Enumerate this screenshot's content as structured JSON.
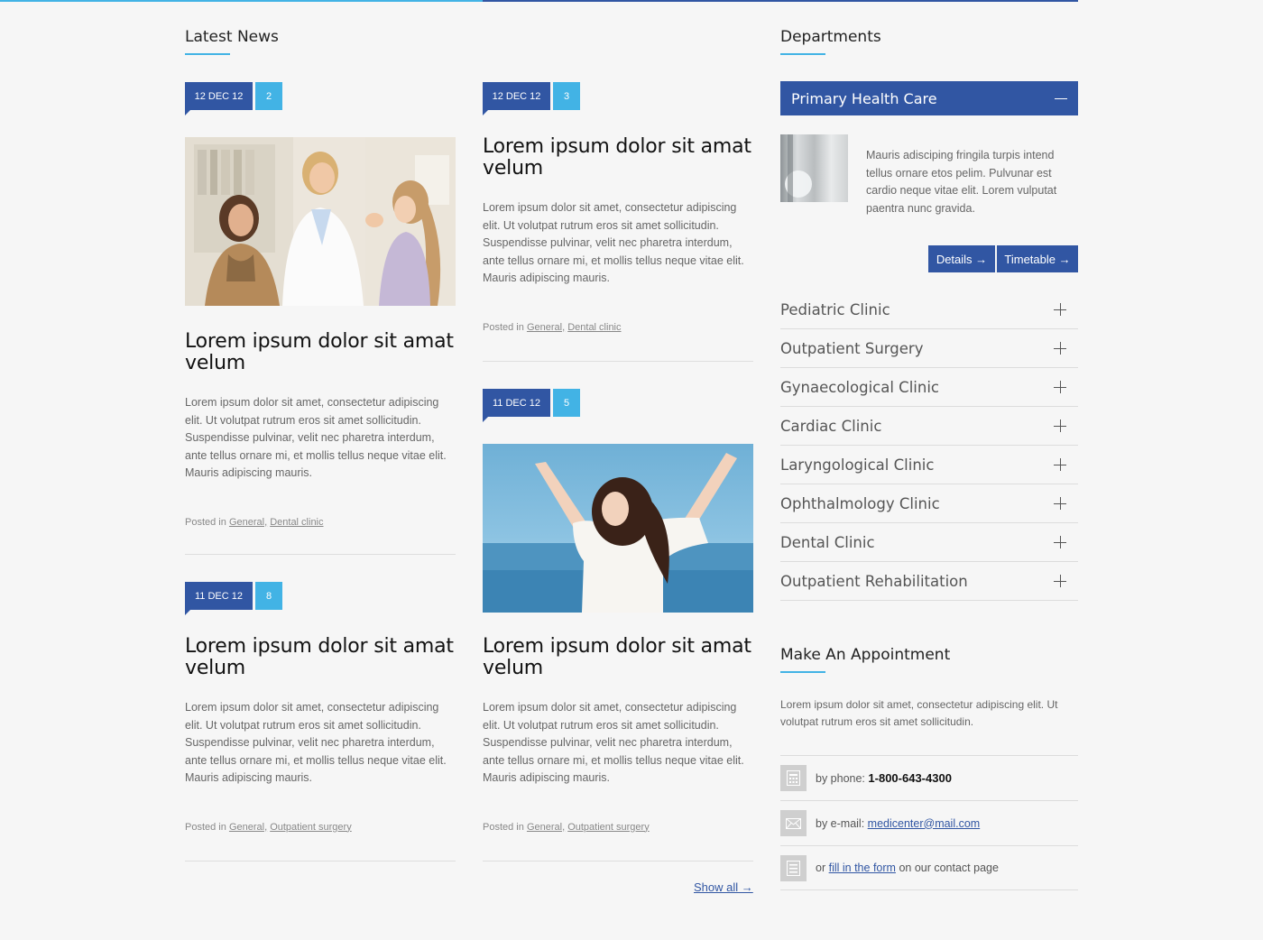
{
  "latest_news": {
    "heading": "Latest News",
    "articles": [
      {
        "date": "12 DEC 12",
        "comments": "2",
        "title": "Lorem ipsum dolor sit amat velum",
        "text": "Lorem ipsum dolor sit amet, consectetur adipiscing elit. Ut volutpat rutrum eros sit amet sollicitudin. Suspendisse pulvinar, velit nec pharetra interdum, ante tellus ornare mi, et mollis tellus neque vitae elit. Mauris adipiscing mauris.",
        "posted_in": "Posted in",
        "cat1": "General,",
        "cat2": "Dental clinic"
      },
      {
        "date": "12 DEC 12",
        "comments": "3",
        "title": "Lorem ipsum dolor sit amat velum",
        "text": "Lorem ipsum dolor sit amet, consectetur adipiscing elit. Ut volutpat rutrum eros sit amet sollicitudin. Suspendisse pulvinar, velit nec pharetra interdum, ante tellus ornare mi, et mollis tellus neque vitae elit. Mauris adipiscing mauris.",
        "posted_in": "Posted in",
        "cat1": "General,",
        "cat2": "Dental clinic"
      },
      {
        "date": "11 DEC 12",
        "comments": "5",
        "title": "Lorem ipsum dolor sit amat velum",
        "text": "Lorem ipsum dolor sit amet, consectetur adipiscing elit. Ut volutpat rutrum eros sit amet sollicitudin. Suspendisse pulvinar, velit nec pharetra interdum, ante tellus ornare mi, et mollis tellus neque vitae elit. Mauris adipiscing mauris.",
        "posted_in": "Posted in",
        "cat1": "General,",
        "cat2": "Outpatient surgery"
      },
      {
        "date": "11 DEC 12",
        "comments": "8",
        "title": "Lorem ipsum dolor sit amat velum",
        "text": "Lorem ipsum dolor sit amet, consectetur adipiscing elit. Ut volutpat rutrum eros sit amet sollicitudin. Suspendisse pulvinar, velit nec pharetra interdum, ante tellus ornare mi, et mollis tellus neque vitae elit. Mauris adipiscing mauris.",
        "posted_in": "Posted in",
        "cat1": "General,",
        "cat2": "Outpatient surgery"
      }
    ],
    "show_all": "Show all →"
  },
  "departments": {
    "heading": "Departments",
    "active": {
      "title": "Primary Health Care",
      "description": "Mauris adisciping fringila turpis intend tellus ornare etos pelim. Pulvunar est cardio neque vitae elit. Lorem vulputat paentra nunc gravida.",
      "details_label": "Details →",
      "timetable_label": "Timetable →"
    },
    "items": [
      "Pediatric Clinic",
      "Outpatient Surgery",
      "Gynaecological Clinic",
      "Cardiac Clinic",
      "Laryngological Clinic",
      "Ophthalmology Clinic",
      "Dental Clinic",
      "Outpatient Rehabilitation"
    ]
  },
  "appointment": {
    "heading": "Make An Appointment",
    "text": "Lorem ipsum dolor sit amet, consectetur adipiscing elit. Ut volutpat rutrum eros sit amet sollicitudin.",
    "phone_prefix": "by phone:",
    "phone": "1-800-643-4300",
    "email_prefix": "by e-mail:",
    "email": "medicenter@mail.com",
    "form_prefix": "or",
    "form_link": "fill in the form",
    "form_suffix": "on our contact page"
  },
  "colors": {
    "brand_blue": "#3156a3",
    "accent_cyan": "#42b3e5"
  }
}
